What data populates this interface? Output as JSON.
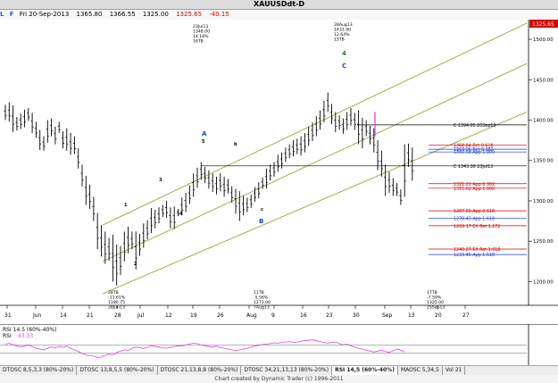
{
  "window": {
    "title": "XAUUSDdt-D"
  },
  "info_bar": {
    "marks": [
      "L",
      "F"
    ],
    "date": "Fri 20-Sep-2013",
    "open": "1365.80",
    "high": "1366.55",
    "low": "1325.00",
    "last": "1325.65",
    "change": "-40.15"
  },
  "colors": {
    "channel": "#8c9a30",
    "bars": "#000000",
    "retrace": "#d00000",
    "projection": "#2030c0",
    "rsi_line": "#e040e0",
    "wave_label": "#1a3ed0",
    "wave4_label": "#208020",
    "price_tag": "#d40000"
  },
  "chart_data": {
    "type": "ohlc",
    "title": "XAUUSDdt-D",
    "y_axis": {
      "ticks": [
        "1500.00",
        "1450.00",
        "1400.00",
        "1350.00",
        "1300.00",
        "1250.00",
        "1200.00"
      ],
      "range": [
        1175,
        1520
      ]
    },
    "x_axis": {
      "ticks": [
        "31",
        "Jun",
        "14",
        "21",
        "28",
        "Jul",
        "12",
        "19",
        "26",
        "Aug",
        "9",
        "16",
        "23",
        "30",
        "Sep",
        "13",
        "20",
        "27"
      ]
    },
    "current_price_tag": "1325.65",
    "bars": [
      [
        1419,
        1400
      ],
      [
        1422,
        1398
      ],
      [
        1418,
        1385
      ],
      [
        1404,
        1387
      ],
      [
        1408,
        1389
      ],
      [
        1413,
        1391
      ],
      [
        1415,
        1399
      ],
      [
        1409,
        1384
      ],
      [
        1398,
        1378
      ],
      [
        1388,
        1363
      ],
      [
        1380,
        1362
      ],
      [
        1400,
        1372
      ],
      [
        1402,
        1380
      ],
      [
        1392,
        1370
      ],
      [
        1398,
        1384
      ],
      [
        1386,
        1365
      ],
      [
        1390,
        1362
      ],
      [
        1384,
        1357
      ],
      [
        1380,
        1358
      ],
      [
        1365,
        1340
      ],
      [
        1345,
        1318
      ],
      [
        1331,
        1295
      ],
      [
        1320,
        1290
      ],
      [
        1305,
        1275
      ],
      [
        1285,
        1240
      ],
      [
        1270,
        1231
      ],
      [
        1262,
        1222
      ],
      [
        1254,
        1226
      ],
      [
        1258,
        1200
      ],
      [
        1246,
        1195
      ],
      [
        1244,
        1208
      ],
      [
        1262,
        1225
      ],
      [
        1268,
        1235
      ],
      [
        1262,
        1240
      ],
      [
        1262,
        1215
      ],
      [
        1259,
        1232
      ],
      [
        1272,
        1242
      ],
      [
        1276,
        1252
      ],
      [
        1291,
        1260
      ],
      [
        1289,
        1266
      ],
      [
        1292,
        1272
      ],
      [
        1295,
        1280
      ],
      [
        1300,
        1279
      ],
      [
        1292,
        1266
      ],
      [
        1293,
        1265
      ],
      [
        1290,
        1281
      ],
      [
        1304,
        1282
      ],
      [
        1310,
        1286
      ],
      [
        1319,
        1296
      ],
      [
        1334,
        1305
      ],
      [
        1341,
        1316
      ],
      [
        1348,
        1326
      ],
      [
        1342,
        1322
      ],
      [
        1338,
        1315
      ],
      [
        1334,
        1311
      ],
      [
        1330,
        1308
      ],
      [
        1334,
        1312
      ],
      [
        1330,
        1305
      ],
      [
        1327,
        1309
      ],
      [
        1318,
        1298
      ],
      [
        1315,
        1284
      ],
      [
        1312,
        1275
      ],
      [
        1306,
        1282
      ],
      [
        1304,
        1286
      ],
      [
        1308,
        1291
      ],
      [
        1317,
        1299
      ],
      [
        1323,
        1303
      ],
      [
        1329,
        1315
      ],
      [
        1340,
        1315
      ],
      [
        1345,
        1325
      ],
      [
        1348,
        1330
      ],
      [
        1357,
        1336
      ],
      [
        1360,
        1340
      ],
      [
        1366,
        1348
      ],
      [
        1370,
        1353
      ],
      [
        1375,
        1355
      ],
      [
        1377,
        1358
      ],
      [
        1380,
        1356
      ],
      [
        1384,
        1360
      ],
      [
        1392,
        1368
      ],
      [
        1397,
        1374
      ],
      [
        1405,
        1380
      ],
      [
        1412,
        1388
      ],
      [
        1424,
        1397
      ],
      [
        1434,
        1410
      ],
      [
        1420,
        1395
      ],
      [
        1410,
        1385
      ],
      [
        1406,
        1388
      ],
      [
        1402,
        1383
      ],
      [
        1410,
        1388
      ],
      [
        1415,
        1393
      ],
      [
        1409,
        1388
      ],
      [
        1412,
        1370
      ],
      [
        1403,
        1365
      ],
      [
        1400,
        1380
      ],
      [
        1393,
        1370
      ],
      [
        1390,
        1360
      ],
      [
        1375,
        1338
      ],
      [
        1362,
        1330
      ],
      [
        1345,
        1306
      ],
      [
        1336,
        1310
      ],
      [
        1328,
        1306
      ],
      [
        1322,
        1306
      ],
      [
        1314,
        1295
      ],
      [
        1370,
        1305
      ],
      [
        1371,
        1342
      ],
      [
        1366,
        1325
      ]
    ],
    "channel_lines": [
      {
        "from": [
          1200,
          1270
        ],
        "to": [
          1440,
          1520
        ]
      },
      {
        "from": [
          1200,
          1185
        ],
        "to": [
          1440,
          1410
        ]
      },
      {
        "from": [
          1200,
          1225
        ],
        "to": [
          1440,
          1470
        ]
      }
    ],
    "horizontal_levels": [
      {
        "price": 1394.05,
        "label": "C 1394.05 25Sep13",
        "color": "#000000"
      },
      {
        "price": 1343.3,
        "label": "C 1343.30 23Jul13",
        "color": "#000000"
      },
      {
        "price": 1368.84,
        "label": "Ret 0.618",
        "color": "#d00000"
      },
      {
        "price": 1363.96,
        "label": "Ret 0.382",
        "color": "#1a3ed0"
      },
      {
        "price": 1360.58,
        "label": "App 1.000",
        "color": "#1a3ed0"
      },
      {
        "price": 1321.21,
        "label": "App 0.382",
        "color": "#d00000"
      },
      {
        "price": 1315.62,
        "label": "App 1.000",
        "color": "#d00000"
      },
      {
        "price": 1287.69,
        "label": "App 0.618",
        "color": "#d00000"
      },
      {
        "price": 1278.45,
        "label": "App 1.618",
        "color": "#1a3ed0"
      },
      {
        "price": 1269.17,
        "label": "EX Ret 1.272",
        "color": "#d00000"
      },
      {
        "price": 1240.27,
        "label": "EX Ret 1.618",
        "color": "#d00000"
      },
      {
        "price": 1233.45,
        "label": "App 1.618",
        "color": "#1a3ed0"
      }
    ],
    "level_labels": {
      "1368.84": "1368.84 Ret 0.618",
      "1363.96": "1363.96 Ret 0.382",
      "1360.58": "1360.58 App 1.000",
      "1321.21": "1321.21 App 0.382",
      "1315.62": "1315.62 App 1.000",
      "1287.69": "1287.69 App 0.618",
      "1278.45": "1278.45 App 1.618",
      "1269.17": "1269.17 EX Ret 1.272",
      "1240.27": "1240.27 EX Ret 1.618",
      "1233.45": "1233.45 App 1.618"
    },
    "annotations": {
      "low_jun": [
        "28TB",
        "-11.61%",
        "1180.75",
        "28Jun13"
      ],
      "high_jul": [
        "23Jul13",
        "1348.00",
        "14.16%",
        "16TB"
      ],
      "low_aug": [
        "11TB",
        "-5.56%",
        "1273.00",
        "7Aug13"
      ],
      "high_aug": [
        "28Aug13",
        "1433.90",
        "12.64%",
        "15TB"
      ],
      "sep_low": [
        "17TB",
        "-7.59%",
        "1325.00",
        "25Sep13"
      ]
    },
    "wave_labels": [
      "A",
      "B",
      "C",
      "4",
      "5",
      "1",
      "2",
      "3",
      "4",
      "5",
      "b",
      "c"
    ]
  },
  "rsi": {
    "label": "RSI 14.5 (60%-40%)",
    "value_label": "RSI",
    "value": "43.33",
    "upper": 60,
    "lower": 40,
    "values": [
      62,
      64,
      60,
      58,
      55,
      57,
      60,
      56,
      52,
      50,
      48,
      52,
      55,
      53,
      56,
      54,
      57,
      52,
      48,
      44,
      40,
      36,
      34,
      33,
      30,
      31,
      35,
      38,
      36,
      42,
      45,
      48,
      47,
      52,
      55,
      53,
      51,
      54,
      58,
      56,
      55,
      53,
      52,
      54,
      56,
      58,
      57,
      60,
      62,
      64,
      63,
      60,
      58,
      56,
      55,
      57,
      54,
      52,
      50,
      48,
      46,
      48,
      50,
      52,
      55,
      57,
      59,
      61,
      62,
      63,
      65,
      64,
      66,
      67,
      68,
      66,
      67,
      69,
      70,
      71,
      72,
      70,
      68,
      66,
      64,
      66,
      67,
      63,
      60,
      62,
      58,
      54,
      52,
      50,
      47,
      45,
      43,
      45,
      47,
      44,
      42,
      46,
      50,
      47,
      43
    ]
  },
  "tabs": [
    "DTOSC 8,5,3,3 (80%-20%)",
    "DTOSC 13,8,5,5 (80%-20%)",
    "DTOSC 21,13,8,8 (80%-20%)",
    "DTOSC 34,21,13,13 (80%-20%)",
    "RSI 14,5 (60%-40%)",
    "MAOSC 5,34,5",
    "Vol 21"
  ],
  "footer": "Chart created by Dynamic Trader  (c) 1996-2011"
}
